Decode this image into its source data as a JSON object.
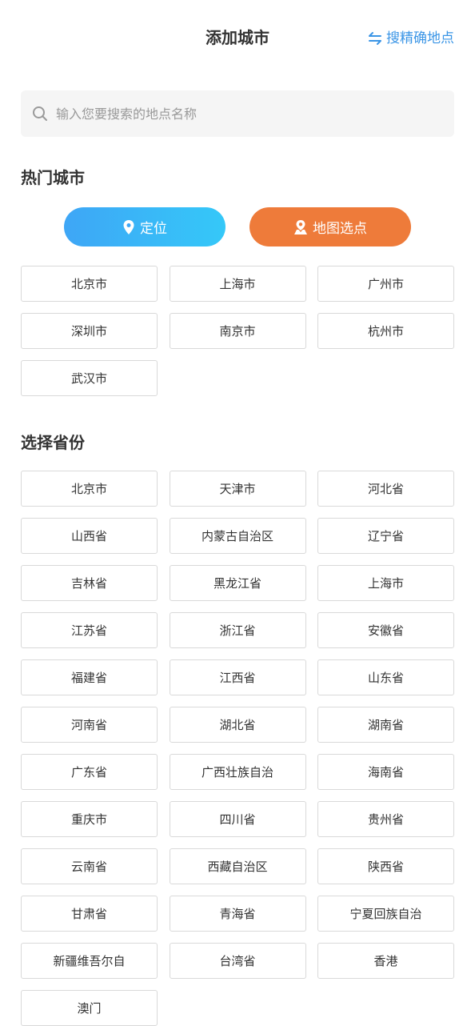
{
  "header": {
    "title": "添加城市",
    "precise_search_label": "搜精确地点",
    "accent_color": "#3a95e6"
  },
  "search": {
    "placeholder": "输入您要搜索的地点名称",
    "value": ""
  },
  "hot_cities": {
    "title": "热门城市",
    "locate_button": "定位",
    "map_pick_button": "地图选点",
    "items": [
      "北京市",
      "上海市",
      "广州市",
      "深圳市",
      "南京市",
      "杭州市",
      "武汉市"
    ]
  },
  "provinces": {
    "title": "选择省份",
    "items": [
      "北京市",
      "天津市",
      "河北省",
      "山西省",
      "内蒙古自治区",
      "辽宁省",
      "吉林省",
      "黑龙江省",
      "上海市",
      "江苏省",
      "浙江省",
      "安徽省",
      "福建省",
      "江西省",
      "山东省",
      "河南省",
      "湖北省",
      "湖南省",
      "广东省",
      "广西壮族自治",
      "海南省",
      "重庆市",
      "四川省",
      "贵州省",
      "云南省",
      "西藏自治区",
      "陕西省",
      "甘肃省",
      "青海省",
      "宁夏回族自治",
      "新疆维吾尔自",
      "台湾省",
      "香港",
      "澳门"
    ]
  },
  "colors": {
    "locate_gradient_start": "#3ea6f6",
    "locate_gradient_end": "#35c8f8",
    "map_button": "#ee7b3a"
  },
  "icons": {
    "precise_search": "swap-arrows-icon",
    "search": "search-icon",
    "locate": "location-pin-icon",
    "map_pick": "map-user-pin-icon"
  }
}
